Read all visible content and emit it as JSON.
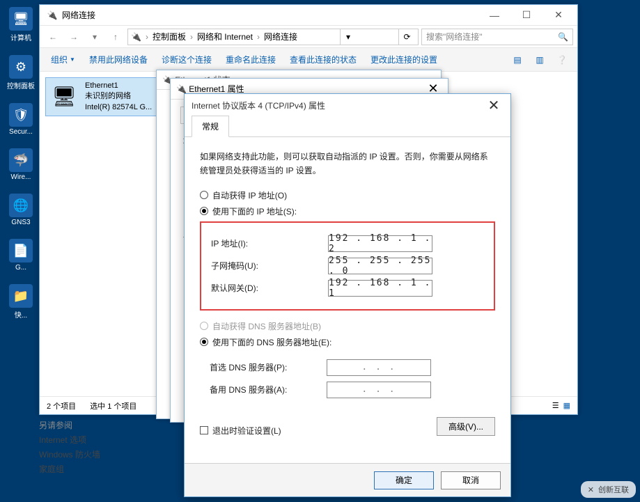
{
  "desktop": {
    "icons": [
      "计算机",
      "控制面板",
      "Secur...",
      "Wire...",
      "GNS3",
      "G...",
      "快..."
    ]
  },
  "explorer": {
    "title": "网络连接",
    "breadcrumb": [
      "控制面板",
      "网络和 Internet",
      "网络连接"
    ],
    "search_placeholder": "搜索\"网络连接\"",
    "commands": {
      "organize": "组织",
      "disable": "禁用此网络设备",
      "diagnose": "诊断这个连接",
      "rename": "重命名此连接",
      "viewstatus": "查看此连接的状态",
      "changesettings": "更改此连接的设置"
    },
    "nic": {
      "name": "Ethernet1",
      "status": "未识别的网络",
      "device": "Intel(R) 82574L G..."
    },
    "statusbar": {
      "count": "2 个项目",
      "selected": "选中 1 个项目"
    }
  },
  "seealso": {
    "a": "另请参阅",
    "b": "Internet 选项",
    "c": "Windows 防火墙",
    "d": "家庭组"
  },
  "propwin1": {
    "title": "Ethernet1 状态"
  },
  "propwin2": {
    "title": "Ethernet1 属性",
    "side": "网络",
    "conn": "连"
  },
  "ipdialog": {
    "title": "Internet 协议版本 4 (TCP/IPv4) 属性",
    "tab": "常规",
    "desc": "如果网络支持此功能，则可以获取自动指派的 IP 设置。否则，你需要从网络系统管理员处获得适当的 IP 设置。",
    "r1": "自动获得 IP 地址(O)",
    "r2": "使用下面的 IP 地址(S):",
    "f_ip": "IP 地址(I):",
    "f_mask": "子网掩码(U):",
    "f_gw": "默认网关(D):",
    "v_ip": "192 . 168 .  1  .  2",
    "v_mask": "255 . 255 . 255 .  0",
    "v_gw": "192 . 168 .  1  .  1",
    "r3": "自动获得 DNS 服务器地址(B)",
    "r4": "使用下面的 DNS 服务器地址(E):",
    "f_dns1": "首选 DNS 服务器(P):",
    "f_dns2": "备用 DNS 服务器(A):",
    "dns_blank": ".     .     .",
    "chk": "退出时验证设置(L)",
    "adv": "高级(V)...",
    "ok": "确定",
    "cancel": "取消"
  },
  "watermark": "创新互联"
}
